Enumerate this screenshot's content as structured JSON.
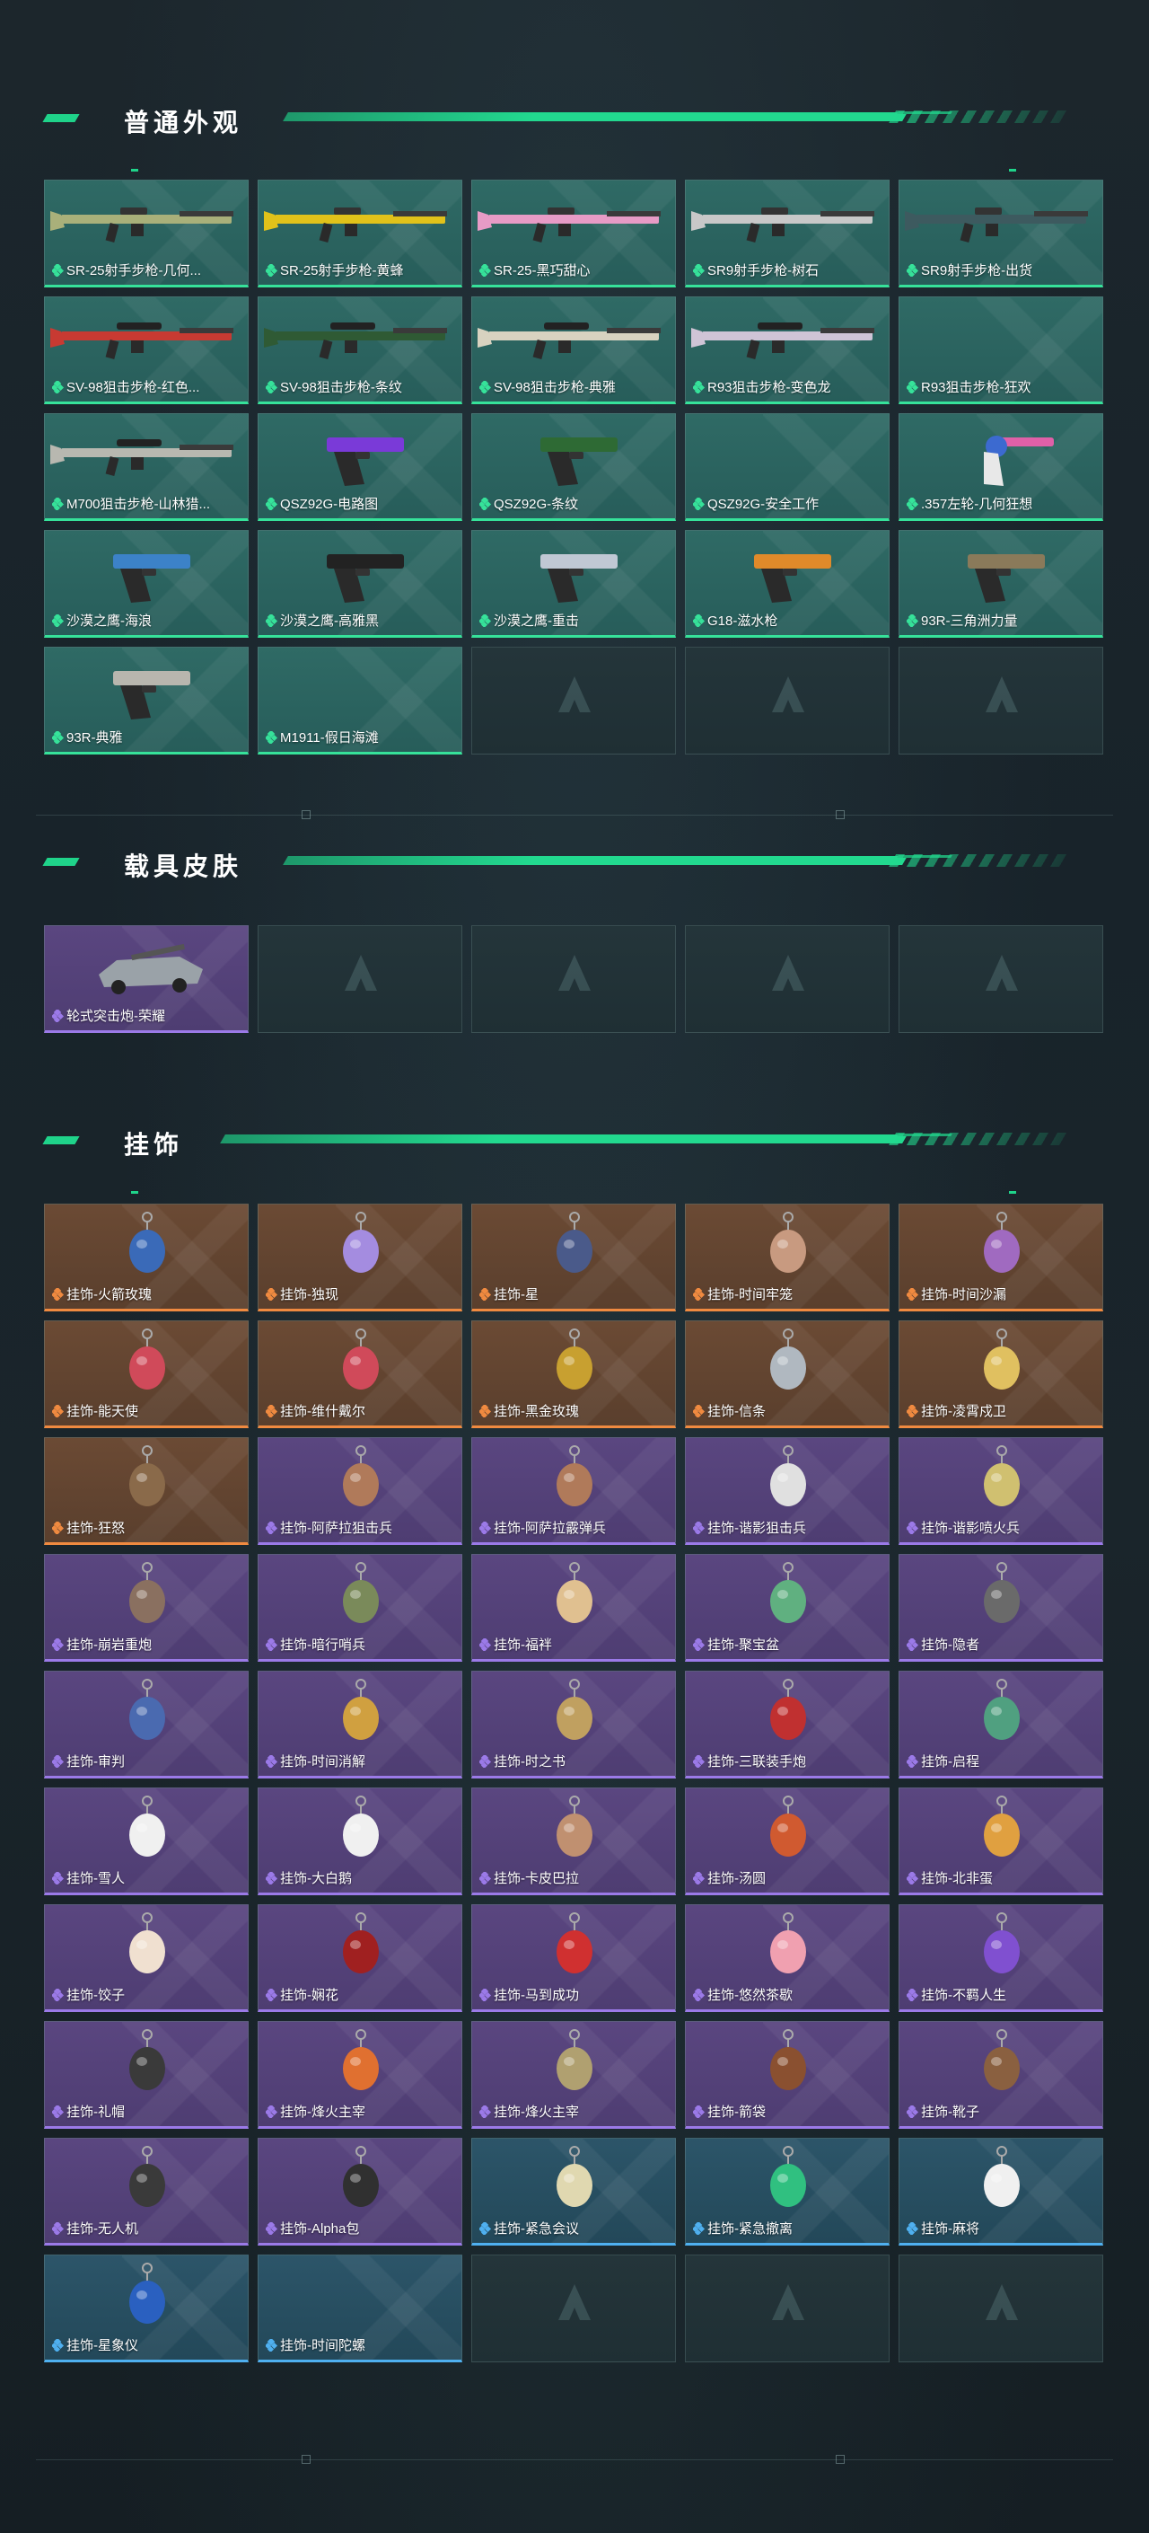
{
  "sections": [
    {
      "title": "普通外观",
      "rarity": "green",
      "items": [
        {
          "label": "SR-25射手步枪-几何...",
          "icon": "rifle-icon",
          "art": "rifle",
          "color": "#a9b07a"
        },
        {
          "label": "SR-25射手步枪-黄蜂",
          "icon": "rifle-icon",
          "art": "rifle",
          "color": "#e1c21a"
        },
        {
          "label": "SR-25-黑巧甜心",
          "icon": "rifle-icon",
          "art": "rifle",
          "color": "#e79bc6"
        },
        {
          "label": "SR9射手步枪-树石",
          "icon": "rifle-icon",
          "art": "rifle",
          "color": "#c8c8c8"
        },
        {
          "label": "SR9射手步枪-出货",
          "icon": "rifle-icon",
          "art": "rifle",
          "color": "#3d5a5f"
        },
        {
          "label": "SV-98狙击步枪-红色...",
          "icon": "sniper-rifle-icon",
          "art": "sniper",
          "color": "#c83a32"
        },
        {
          "label": "SV-98狙击步枪-条纹",
          "icon": "sniper-rifle-icon",
          "art": "sniper",
          "color": "#2f5a34"
        },
        {
          "label": "SV-98狙击步枪-典雅",
          "icon": "sniper-rifle-icon",
          "art": "sniper",
          "color": "#d8d2c0"
        },
        {
          "label": "R93狙击步枪-变色龙",
          "icon": "sniper-rifle-icon",
          "art": "sniper",
          "color": "#cfc4d6"
        },
        {
          "label": "R93狙击步枪-狂欢",
          "icon": "sniper-rifle-icon",
          "art": "none",
          "color": "#2a6a62"
        },
        {
          "label": "M700狙击步枪-山林猎...",
          "icon": "sniper-rifle-icon",
          "art": "sniper",
          "color": "#b8b8b0"
        },
        {
          "label": "QSZ92G-电路图",
          "icon": "pistol-icon",
          "art": "pistol",
          "color": "#7a3ad8"
        },
        {
          "label": "QSZ92G-条纹",
          "icon": "pistol-icon",
          "art": "pistol",
          "color": "#2e6a34"
        },
        {
          "label": "QSZ92G-安全工作",
          "icon": "pistol-icon",
          "art": "none",
          "color": "#2a6a62"
        },
        {
          "label": ".357左轮-几何狂想",
          "icon": "revolver-icon",
          "art": "revolver",
          "color": "#e060a8"
        },
        {
          "label": "沙漠之鹰-海浪",
          "icon": "pistol-icon",
          "art": "deagle",
          "color": "#3c82c8"
        },
        {
          "label": "沙漠之鹰-高雅黑",
          "icon": "pistol-icon",
          "art": "deagle",
          "color": "#222222"
        },
        {
          "label": "沙漠之鹰-重击",
          "icon": "pistol-icon",
          "art": "deagle",
          "color": "#c0c8d4"
        },
        {
          "label": "G18-滋水枪",
          "icon": "pistol-icon",
          "art": "pistol",
          "color": "#e08a2a"
        },
        {
          "label": "93R-三角洲力量",
          "icon": "pistol-icon",
          "art": "pistol",
          "color": "#8a7a5a"
        },
        {
          "label": "93R-典雅",
          "icon": "pistol-icon",
          "art": "pistol",
          "color": "#b8b6ae"
        },
        {
          "label": "M1911-假日海滩",
          "icon": "pistol-icon",
          "art": "none",
          "color": "#2a6a62"
        }
      ],
      "empty_count": 3
    },
    {
      "title": "载具皮肤",
      "rarity": "purple",
      "items": [
        {
          "label": "轮式突击炮-荣耀",
          "icon": "vehicle-icon",
          "art": "vehicle",
          "color": "#9aa2a8"
        }
      ],
      "empty_count": 4
    },
    {
      "title": "挂饰",
      "items": [
        {
          "label": "挂饰-火箭玫瑰",
          "rarity": "orange",
          "art": "charm",
          "color": "#3a6ab8"
        },
        {
          "label": "挂饰-独现",
          "rarity": "orange",
          "art": "charm",
          "color": "#a48ce0"
        },
        {
          "label": "挂饰-星",
          "rarity": "orange",
          "art": "charm",
          "color": "#4a5a8a"
        },
        {
          "label": "挂饰-时间牢笼",
          "rarity": "orange",
          "art": "charm",
          "color": "#c89a80"
        },
        {
          "label": "挂饰-时间沙漏",
          "rarity": "orange",
          "art": "charm",
          "color": "#a06ac0"
        },
        {
          "label": "挂饰-能天使",
          "rarity": "orange",
          "art": "charm",
          "color": "#d04a5a"
        },
        {
          "label": "挂饰-维什戴尔",
          "rarity": "orange",
          "art": "charm",
          "color": "#d04a5a"
        },
        {
          "label": "挂饰-黑金玫瑰",
          "rarity": "orange",
          "art": "charm",
          "color": "#c8a030"
        },
        {
          "label": "挂饰-信条",
          "rarity": "orange",
          "art": "charm",
          "color": "#b0b8c0"
        },
        {
          "label": "挂饰-凌霄戍卫",
          "rarity": "orange",
          "art": "charm",
          "color": "#e0c060"
        },
        {
          "label": "挂饰-狂怒",
          "rarity": "orange",
          "art": "charm",
          "color": "#8a6a4a"
        },
        {
          "label": "挂饰-阿萨拉狙击兵",
          "rarity": "purple",
          "art": "charm",
          "color": "#b07a5a"
        },
        {
          "label": "挂饰-阿萨拉霰弹兵",
          "rarity": "purple",
          "art": "charm",
          "color": "#b07a5a"
        },
        {
          "label": "挂饰-谐影狙击兵",
          "rarity": "purple",
          "art": "charm",
          "color": "#e0e0e0"
        },
        {
          "label": "挂饰-谐影喷火兵",
          "rarity": "purple",
          "art": "charm",
          "color": "#d0c070"
        },
        {
          "label": "挂饰-崩岩重炮",
          "rarity": "purple",
          "art": "charm",
          "color": "#8a7060"
        },
        {
          "label": "挂饰-暗行哨兵",
          "rarity": "purple",
          "art": "charm",
          "color": "#7a8a5a"
        },
        {
          "label": "挂饰-福袢",
          "rarity": "purple",
          "art": "charm",
          "color": "#e0c090"
        },
        {
          "label": "挂饰-聚宝盆",
          "rarity": "purple",
          "art": "charm",
          "color": "#60b080"
        },
        {
          "label": "挂饰-隐者",
          "rarity": "purple",
          "art": "charm",
          "color": "#6a6a6a"
        },
        {
          "label": "挂饰-审判",
          "rarity": "purple",
          "art": "charm",
          "color": "#4a6ab0"
        },
        {
          "label": "挂饰-时间消解",
          "rarity": "purple",
          "art": "charm",
          "color": "#d0a040"
        },
        {
          "label": "挂饰-时之书",
          "rarity": "purple",
          "art": "charm",
          "color": "#c0a060"
        },
        {
          "label": "挂饰-三联装手炮",
          "rarity": "purple",
          "art": "charm",
          "color": "#c03030"
        },
        {
          "label": "挂饰-启程",
          "rarity": "purple",
          "art": "charm",
          "color": "#50a080"
        },
        {
          "label": "挂饰-雪人",
          "rarity": "purple",
          "art": "charm",
          "color": "#f0f0f0"
        },
        {
          "label": "挂饰-大白鹅",
          "rarity": "purple",
          "art": "charm",
          "color": "#f0f0f0"
        },
        {
          "label": "挂饰-卡皮巴拉",
          "rarity": "purple",
          "art": "charm",
          "color": "#c09070"
        },
        {
          "label": "挂饰-汤圆",
          "rarity": "purple",
          "art": "charm",
          "color": "#d05a30"
        },
        {
          "label": "挂饰-北非蛋",
          "rarity": "purple",
          "art": "charm",
          "color": "#e0a040"
        },
        {
          "label": "挂饰-饺子",
          "rarity": "purple",
          "art": "charm",
          "color": "#f0e0d0"
        },
        {
          "label": "挂饰-娴花",
          "rarity": "purple",
          "art": "charm",
          "color": "#a02020"
        },
        {
          "label": "挂饰-马到成功",
          "rarity": "purple",
          "art": "charm",
          "color": "#d03030"
        },
        {
          "label": "挂饰-悠然茶歇",
          "rarity": "purple",
          "art": "charm",
          "color": "#f0a0b0"
        },
        {
          "label": "挂饰-不羁人生",
          "rarity": "purple",
          "art": "charm",
          "color": "#8050d0"
        },
        {
          "label": "挂饰-礼帽",
          "rarity": "purple",
          "art": "charm",
          "color": "#3a3a3a"
        },
        {
          "label": "挂饰-烽火主宰",
          "rarity": "purple",
          "art": "charm",
          "color": "#e07030"
        },
        {
          "label": "挂饰-烽火主宰",
          "rarity": "purple",
          "art": "charm",
          "color": "#b0a070"
        },
        {
          "label": "挂饰-箭袋",
          "rarity": "purple",
          "art": "charm",
          "color": "#8a5030"
        },
        {
          "label": "挂饰-靴子",
          "rarity": "purple",
          "art": "charm",
          "color": "#8a6040"
        },
        {
          "label": "挂饰-无人机",
          "rarity": "purple",
          "art": "charm",
          "color": "#3a3a3a"
        },
        {
          "label": "挂饰-Alpha包",
          "rarity": "purple",
          "art": "charm",
          "color": "#303030"
        },
        {
          "label": "挂饰-紧急会议",
          "rarity": "blue",
          "art": "charm",
          "color": "#e0d8b0"
        },
        {
          "label": "挂饰-紧急撤离",
          "rarity": "blue",
          "art": "charm",
          "color": "#30c080"
        },
        {
          "label": "挂饰-麻将",
          "rarity": "blue",
          "art": "charm",
          "color": "#f0f0f0"
        },
        {
          "label": "挂饰-星象仪",
          "rarity": "blue",
          "art": "charm",
          "color": "#2a60c0"
        },
        {
          "label": "挂饰-时间陀螺",
          "rarity": "blue",
          "art": "none",
          "color": "#2a5068"
        }
      ],
      "empty_count": 3
    }
  ],
  "rarity_colors": {
    "green": "#36e29a",
    "purple": "#9b7ae8",
    "orange": "#f08a40",
    "blue": "#4fb0f0"
  }
}
